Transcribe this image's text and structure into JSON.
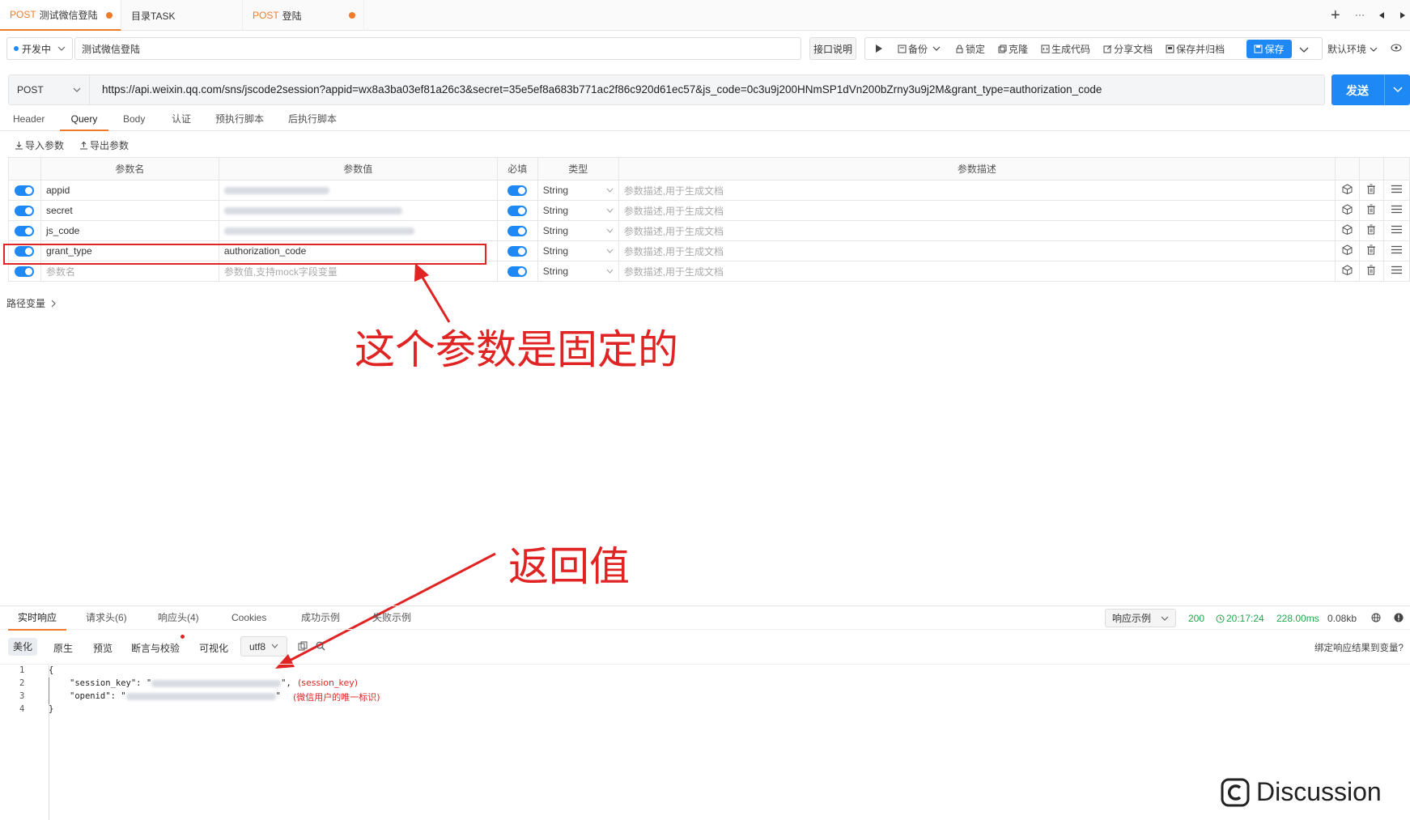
{
  "tabs": [
    {
      "method": "POST",
      "title": "测试微信登陆",
      "modified": true
    },
    {
      "method": "",
      "title": "目录TASK",
      "modified": false
    },
    {
      "method": "POST",
      "title": "登陆",
      "modified": true
    }
  ],
  "window_controls": {
    "add": "+",
    "more": "···"
  },
  "toolbar": {
    "status": "开发中",
    "api_name": "测试微信登陆",
    "doc": "接口说明",
    "backup": "备份",
    "lock": "锁定",
    "clone": "克隆",
    "gen_code": "生成代码",
    "share": "分享文档",
    "save_archive": "保存并归档",
    "save": "保存",
    "env": "默认环境"
  },
  "request": {
    "method": "POST",
    "url": "https://api.weixin.qq.com/sns/jscode2session?appid=wx8a3ba03ef81a26c3&secret=35e5ef8a683b771ac2f86c920d61ec57&js_code=0c3u9j200HNmSP1dVn200bZrny3u9j2M&grant_type=authorization_code",
    "send": "发送"
  },
  "subtabs": [
    "Header",
    "Query",
    "Body",
    "认证",
    "预执行脚本",
    "后执行脚本"
  ],
  "params_actions": {
    "import": "导入参数",
    "export": "导出参数"
  },
  "params_headers": {
    "name": "参数名",
    "value": "参数值",
    "required": "必填",
    "type": "类型",
    "desc": "参数描述"
  },
  "params": [
    {
      "name": "appid",
      "value": "",
      "blurred": true,
      "type": "String",
      "desc": "参数描述,用于生成文档"
    },
    {
      "name": "secret",
      "value": "",
      "blurred": true,
      "type": "String",
      "desc": "参数描述,用于生成文档"
    },
    {
      "name": "js_code",
      "value": "",
      "blurred": true,
      "type": "String",
      "desc": "参数描述,用于生成文档"
    },
    {
      "name": "grant_type",
      "value": "authorization_code",
      "blurred": false,
      "type": "String",
      "desc": "参数描述,用于生成文档"
    },
    {
      "name": "参数名",
      "value": "参数值,支持mock字段变量",
      "blurred": false,
      "placeholder": true,
      "type": "String",
      "desc": "参数描述,用于生成文档"
    }
  ],
  "path_vars": "路径变量",
  "annotations": {
    "fixed_param": "这个参数是固定的",
    "return_value": "返回值"
  },
  "response": {
    "tabs": [
      "实时响应",
      "请求头(6)",
      "响应头(4)",
      "Cookies",
      "成功示例",
      "失败示例"
    ],
    "example": "响应示例",
    "status": "200",
    "time": "20:17:24",
    "duration": "228.00ms",
    "size": "0.08kb",
    "view_tabs": [
      "美化",
      "原生",
      "预览",
      "断言与校验",
      "可视化"
    ],
    "encoding": "utf8",
    "bind": "绑定响应结果到变量?",
    "lines": [
      {
        "n": "1",
        "text": "{"
      },
      {
        "n": "2",
        "text": "\"session_key\": \"",
        "comment": "(session_key)"
      },
      {
        "n": "3",
        "text": "\"openid\": \"",
        "comment": "(微信用户的唯一标识)"
      },
      {
        "n": "4",
        "text": "}"
      }
    ]
  },
  "watermark": "Discussion",
  "colors": {
    "accent": "#f07a2b",
    "primary": "#1e88f5",
    "annotation": "#e02424",
    "success": "#20a74a"
  }
}
